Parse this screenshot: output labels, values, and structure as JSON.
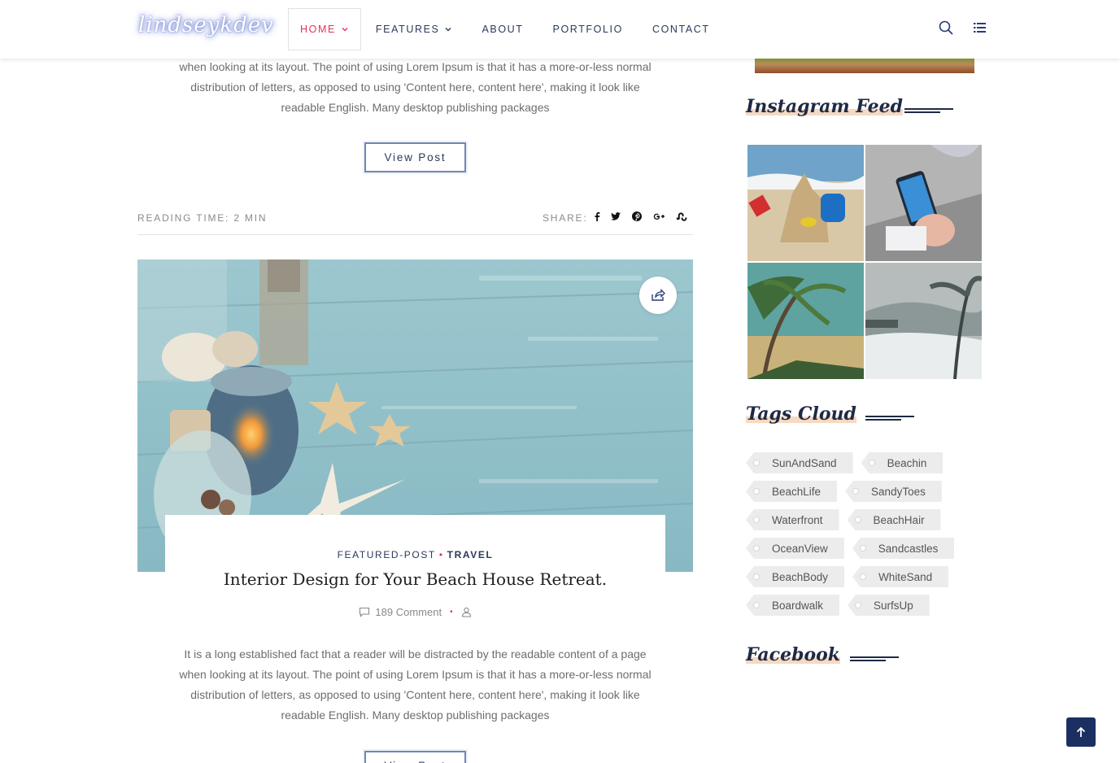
{
  "header": {
    "logo": "lindseykdev",
    "nav": [
      {
        "label": "HOME",
        "has_dropdown": true,
        "active": true
      },
      {
        "label": "FEATURES",
        "has_dropdown": true,
        "active": false
      },
      {
        "label": "ABOUT",
        "has_dropdown": false,
        "active": false
      },
      {
        "label": "PORTFOLIO",
        "has_dropdown": false,
        "active": false
      },
      {
        "label": "CONTACT",
        "has_dropdown": false,
        "active": false
      }
    ],
    "icons": [
      "search-icon",
      "list-menu-icon"
    ]
  },
  "previous_post": {
    "excerpt_lines": [
      "when looking at its layout. The point of using Lorem Ipsum is that it has a more-or-less normal",
      "distribution of letters, as opposed to using 'Content here, content here', making it look like",
      "readable English. Many desktop publishing packages"
    ],
    "button": "View Post",
    "reading_time": "READING TIME: 2 MIN",
    "share_label": "SHARE:",
    "share_icons": [
      "facebook-icon",
      "twitter-icon",
      "pinterest-icon",
      "google-plus-icon",
      "stumbleupon-icon"
    ]
  },
  "post": {
    "categories": [
      "FEATURED-POST",
      "TRAVEL"
    ],
    "separator": "•",
    "title": "Interior Design for Your Beach House Retreat.",
    "comments": "189 Comment",
    "excerpt_lines": [
      "It is a long established fact that a reader will be distracted by the readable content of a page",
      "when looking at its layout. The point of using Lorem Ipsum is that it has a more-or-less normal",
      "distribution of letters, as opposed to using 'Content here, content here', making it look like",
      "readable English. Many desktop publishing packages"
    ],
    "button": "View Post"
  },
  "sidebar": {
    "instagram_title": "Instagram Feed",
    "tags_title": "Tags Cloud",
    "tags": [
      [
        "SunAndSand",
        "Beachin"
      ],
      [
        "BeachLife",
        "SandyToes"
      ],
      [
        "Waterfront",
        "BeachHair"
      ],
      [
        "OceanView",
        "Sandcastles"
      ],
      [
        "BeachBody",
        "WhiteSand"
      ],
      [
        "Boardwalk",
        "SurfsUp"
      ]
    ],
    "facebook_title": "Facebook"
  },
  "colors": {
    "accent": "#e0335c",
    "navy": "#1c2f63",
    "text": "#6d6d6d"
  }
}
